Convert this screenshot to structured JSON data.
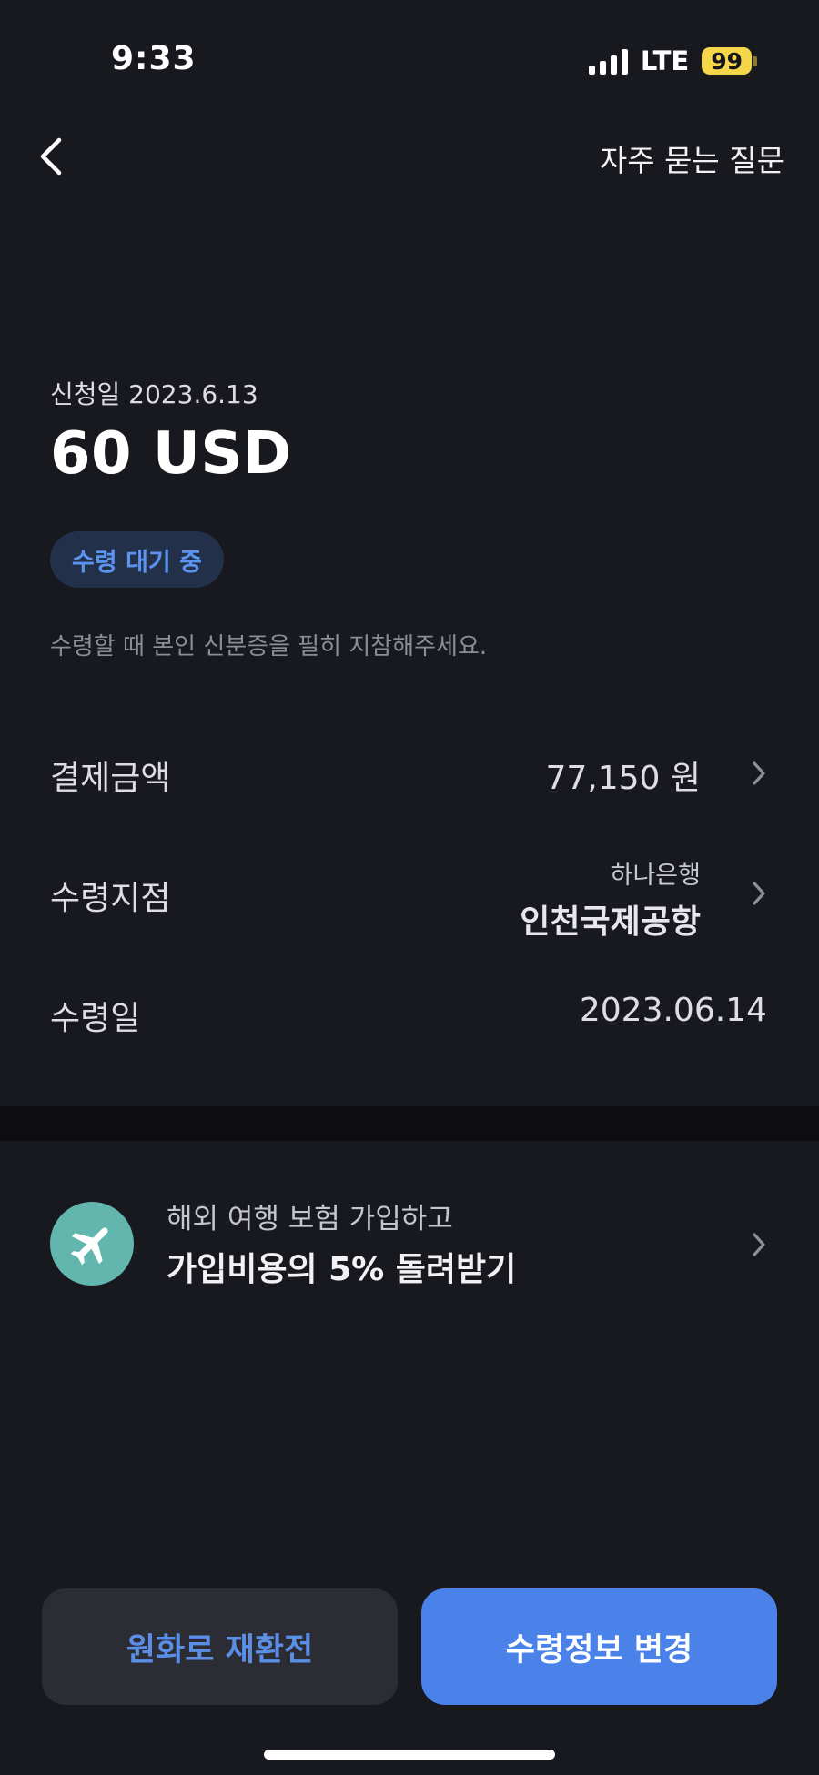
{
  "status_bar": {
    "time": "9:33",
    "network": "LTE",
    "battery": "99",
    "battery_color": "#f5d64a"
  },
  "nav": {
    "back_icon": "chevron-left-icon",
    "faq_label": "자주 묻는 질문"
  },
  "summary": {
    "apply_date": "신청일 2023.6.13",
    "amount": "60 USD",
    "status": "수령 대기 중",
    "notice": "수령할 때 본인 신분증을 필히 지참해주세요."
  },
  "details": {
    "payment": {
      "label": "결제금액",
      "value": "77,150 원"
    },
    "branch": {
      "label": "수령지점",
      "bank": "하나은행",
      "name": "인천국제공항"
    },
    "pickup_date": {
      "label": "수령일",
      "value": "2023.06.14"
    }
  },
  "promo": {
    "icon": "airplane-icon",
    "subtitle": "해외 여행 보험 가입하고",
    "title": "가입비용의 5% 돌려받기",
    "icon_color": "#62b6ad"
  },
  "actions": {
    "reconvert_label": "원화로 재환전",
    "change_label": "수령정보 변경",
    "accent_color": "#4a82ea"
  }
}
